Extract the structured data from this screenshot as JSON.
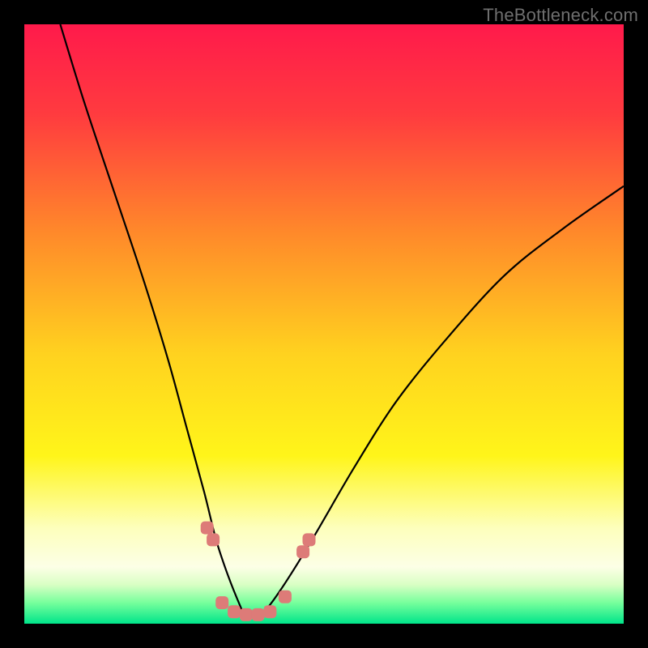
{
  "watermark": {
    "text": "TheBottleneck.com"
  },
  "chart_data": {
    "type": "line",
    "title": "",
    "xlabel": "",
    "ylabel": "",
    "xlim": [
      0,
      100
    ],
    "ylim": [
      0,
      100
    ],
    "grid": false,
    "annotations": [],
    "series": [
      {
        "name": "bottleneck-curve",
        "color": "#000000",
        "x": [
          6,
          10,
          15,
          20,
          24,
          27,
          30,
          32,
          34,
          36,
          37,
          38,
          40,
          43,
          48,
          55,
          62,
          70,
          80,
          90,
          100
        ],
        "y": [
          100,
          87,
          72,
          57,
          44,
          33,
          22,
          14,
          8,
          3,
          1,
          1,
          2,
          6,
          14,
          26,
          37,
          47,
          58,
          66,
          73
        ]
      }
    ],
    "markers": {
      "name": "highlight-dots",
      "color": "#dd7b78",
      "points": [
        {
          "x": 30.5,
          "y": 16
        },
        {
          "x": 31.5,
          "y": 14
        },
        {
          "x": 33,
          "y": 3.5
        },
        {
          "x": 35,
          "y": 2.0
        },
        {
          "x": 37,
          "y": 1.5
        },
        {
          "x": 39,
          "y": 1.5
        },
        {
          "x": 41,
          "y": 2.0
        },
        {
          "x": 43.5,
          "y": 4.5
        },
        {
          "x": 46.5,
          "y": 12
        },
        {
          "x": 47.5,
          "y": 14
        }
      ]
    },
    "background_gradient": {
      "stops": [
        {
          "offset": 0.0,
          "color": "#ff1a4b"
        },
        {
          "offset": 0.15,
          "color": "#ff3b3f"
        },
        {
          "offset": 0.35,
          "color": "#ff8a2a"
        },
        {
          "offset": 0.55,
          "color": "#ffd21f"
        },
        {
          "offset": 0.72,
          "color": "#fff51a"
        },
        {
          "offset": 0.84,
          "color": "#fdffbc"
        },
        {
          "offset": 0.905,
          "color": "#fcffe6"
        },
        {
          "offset": 0.935,
          "color": "#d9ffc4"
        },
        {
          "offset": 0.965,
          "color": "#77ff9c"
        },
        {
          "offset": 1.0,
          "color": "#00e58a"
        }
      ]
    }
  }
}
